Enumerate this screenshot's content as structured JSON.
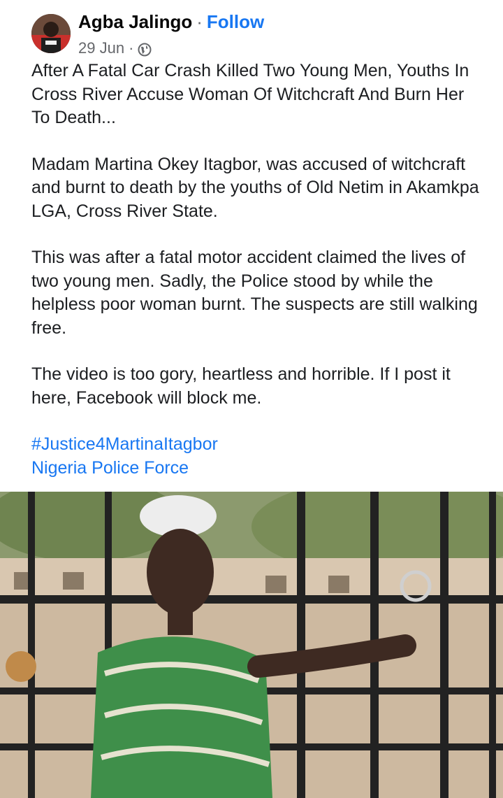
{
  "post": {
    "author": "Agba Jalingo",
    "separator": "·",
    "follow_label": "Follow",
    "date": "29 Jun",
    "meta_separator": "·",
    "audience_icon": "globe-icon",
    "paragraphs": [
      "After A Fatal Car Crash Killed Two Young Men, Youths In Cross River Accuse Woman Of Witchcraft And Burn Her To Death...",
      "Madam Martina Okey Itagbor, was accused of witchcraft and burnt to death by the youths of Old Netim in Akamkpa LGA, Cross River State.",
      "This was after a fatal motor accident claimed the lives of two young men. Sadly, the Police stood by while the helpless poor woman burnt. The suspects are still walking free.",
      "The video is too gory, heartless and horrible. If I post it here, Facebook will block me."
    ],
    "hashtag": "#Justice4MartinaItagbor",
    "mention": "Nigeria Police Force"
  },
  "colors": {
    "link": "#1877f2",
    "secondary_text": "#65676b",
    "primary_text": "#1c1e21"
  }
}
